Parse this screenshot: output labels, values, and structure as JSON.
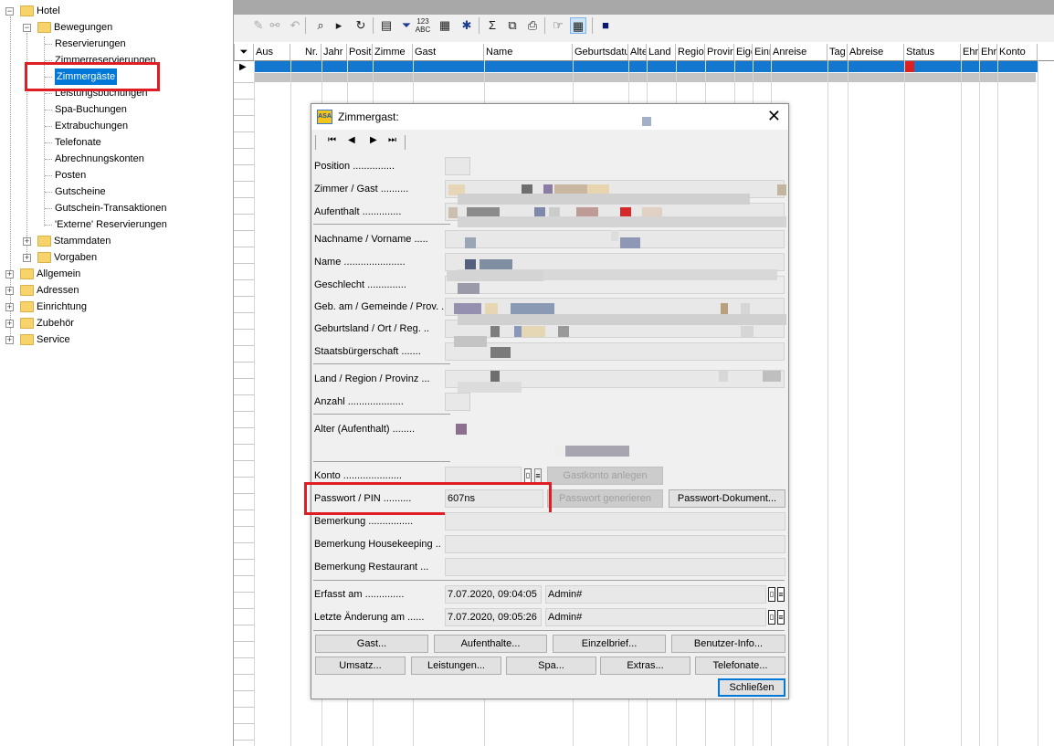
{
  "tree": {
    "root": "Hotel",
    "bewegungen": "Bewegungen",
    "items": [
      "Reservierungen",
      "Zimmerreservierungen",
      "Zimmergäste",
      "Leistungsbuchungen",
      "Spa-Buchungen",
      "Extrabuchungen",
      "Telefonate",
      "Abrechnungskonten",
      "Posten",
      "Gutscheine",
      "Gutschein-Transaktionen",
      "'Externe' Reservierungen"
    ],
    "sub_groups": [
      "Stammdaten",
      "Vorgaben"
    ],
    "top_groups": [
      "Allgemein",
      "Adressen",
      "Einrichtung",
      "Zubehör",
      "Service"
    ]
  },
  "grid": {
    "columns": [
      "Aus",
      "Nr.",
      "Jahr",
      "Positi",
      "Zimme",
      "Gast",
      "Name",
      "Geburtsdatu",
      "Alte",
      "Land",
      "Regio",
      "Provin",
      "Eige",
      "Einr",
      "Anreise",
      "Tag",
      "Abreise",
      "Status",
      "Ehr",
      "Ehr",
      "Konto"
    ]
  },
  "dialog": {
    "title": "Zimmergast:",
    "labels": {
      "position": "Position ...............",
      "zimmer_gast": "Zimmer / Gast ..........",
      "aufenthalt": "Aufenthalt ..............",
      "nachname": "Nachname / Vorname .....",
      "name": "Name ......................",
      "geschlecht": "Geschlecht ..............",
      "geb": "Geb. am / Gemeinde / Prov. .",
      "geburtsland": "Geburtsland / Ort / Reg. ..",
      "staatsbuerger": "Staatsbürgerschaft .......",
      "land": "Land / Region / Provinz ...",
      "anzahl": "Anzahl ....................",
      "alter": "Alter (Aufenthalt) ........",
      "konto": "Konto .....................",
      "passwort": "Passwort / PIN ..........",
      "bemerkung": "Bemerkung ................",
      "bemerkung_hk": "Bemerkung Housekeeping ..",
      "bemerkung_rest": "Bemerkung Restaurant ...",
      "erfasst": "Erfasst am ..............",
      "geaendert": "Letzte Änderung am ......"
    },
    "values": {
      "passwort": "607ns",
      "erfasst_date": "7.07.2020, 09:04:05",
      "erfasst_user": "Admin#",
      "geaendert_date": "7.07.2020, 09:05:26",
      "geaendert_user": "Admin#"
    },
    "buttons": {
      "gastkonto": "Gastkonto anlegen",
      "pw_gen": "Passwort generieren",
      "pw_doc": "Passwort-Dokument...",
      "row1": [
        "Gast...",
        "Aufenthalte...",
        "Einzelbrief...",
        "Benutzer-Info..."
      ],
      "row2": [
        "Umsatz...",
        "Leistungen...",
        "Spa...",
        "Extras...",
        "Telefonate..."
      ],
      "close": "Schließen"
    }
  },
  "colors": {
    "selection": "#0078d7",
    "highlight_box": "#e01c24",
    "folder": "#f6d46b"
  }
}
